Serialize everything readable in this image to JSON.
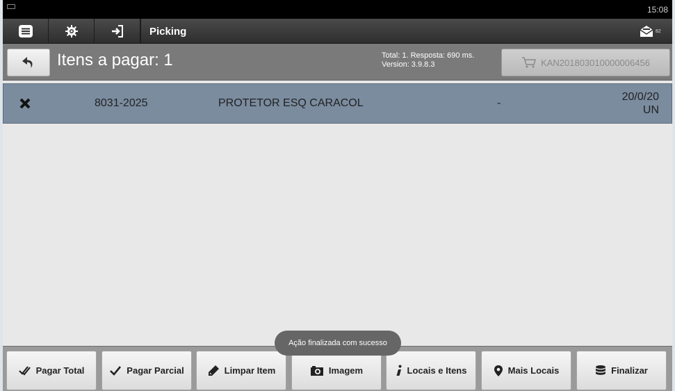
{
  "statusbar": {
    "time": "15:08"
  },
  "toolbar": {
    "title": "Picking",
    "mail_badge": "82",
    "icons": [
      "menu-icon",
      "gear-icon",
      "login-icon",
      "mail-icon"
    ]
  },
  "header": {
    "title": "Itens a pagar: 1",
    "info_line1": "Total: 1. Resposta: 690 ms.",
    "info_line2": "Version: 3.9.8.3",
    "cart_code": "KAN201803010000006456"
  },
  "items": [
    {
      "code": "8031-2025",
      "description": "PROTETOR ESQ CARACOL",
      "dash": "-",
      "qty": "20/0/20",
      "unit": "UN"
    }
  ],
  "toast": "Ação finalizada com sucesso",
  "bottom_buttons": {
    "pagar_total": "Pagar Total",
    "pagar_parcial": "Pagar Parcial",
    "limpar_item": "Limpar Item",
    "imagem": "Imagem",
    "locais_itens": "Locais e Itens",
    "mais_locais": "Mais Locais",
    "finalizar": "Finalizar"
  },
  "colors": {
    "row_selected": "#7b8c9f",
    "toolbar": "#3a3a3a",
    "header": "#7a7a7a"
  }
}
